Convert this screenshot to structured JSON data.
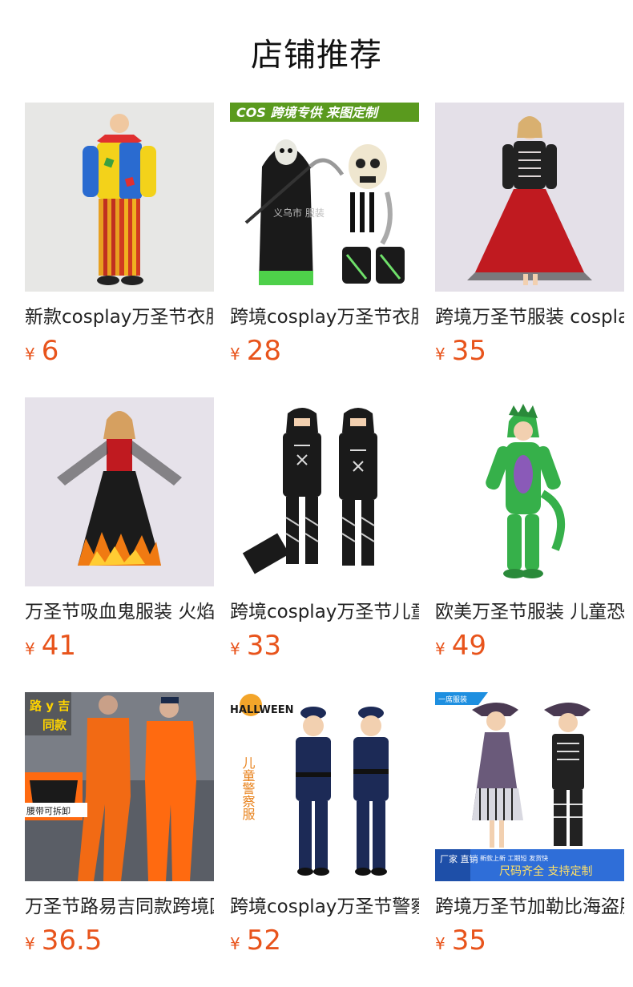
{
  "header": {
    "title": "店铺推荐"
  },
  "products": [
    {
      "name": "新款cosplay万圣节衣服小丑服装成人款",
      "currency": "¥",
      "price": "6"
    },
    {
      "name": "跨境cosplay万圣节衣服儿童死神服装",
      "currency": "¥",
      "price": "28",
      "banner": "COS 跨境专供 来图定制",
      "watermark": "义乌市 服装"
    },
    {
      "name": "跨境万圣节服装 cosplay女童骷髅裙",
      "currency": "¥",
      "price": "35"
    },
    {
      "name": "万圣节吸血鬼服装 火焰长裙女童",
      "currency": "¥",
      "price": "41"
    },
    {
      "name": "跨境cosplay万圣节儿童忍者服装",
      "currency": "¥",
      "price": "33"
    },
    {
      "name": "欧美万圣节服装 儿童恐龙连体衣",
      "currency": "¥",
      "price": "49"
    },
    {
      "name": "万圣节路易吉同款跨境囚服",
      "currency": "¥",
      "price": "36.5",
      "badge_top": "路 y 吉",
      "badge_bottom": "同款",
      "note": "腰带可拆卸"
    },
    {
      "name": "跨境cosplay万圣节警察服装儿童",
      "currency": "¥",
      "price": "52",
      "badge": "HALLWEEN",
      "vertical_text": "儿童警察服"
    },
    {
      "name": "跨境万圣节加勒比海盗服装儿童",
      "currency": "¥",
      "price": "35",
      "corner_tag": "一席服装",
      "strip_left": "厂家 直销",
      "strip_small": "新款上新 工期短 发货快",
      "strip_main": "尺码齐全 支持定制"
    }
  ],
  "colors": {
    "price": "#e8541c",
    "title": "#111111",
    "text": "#222222"
  }
}
